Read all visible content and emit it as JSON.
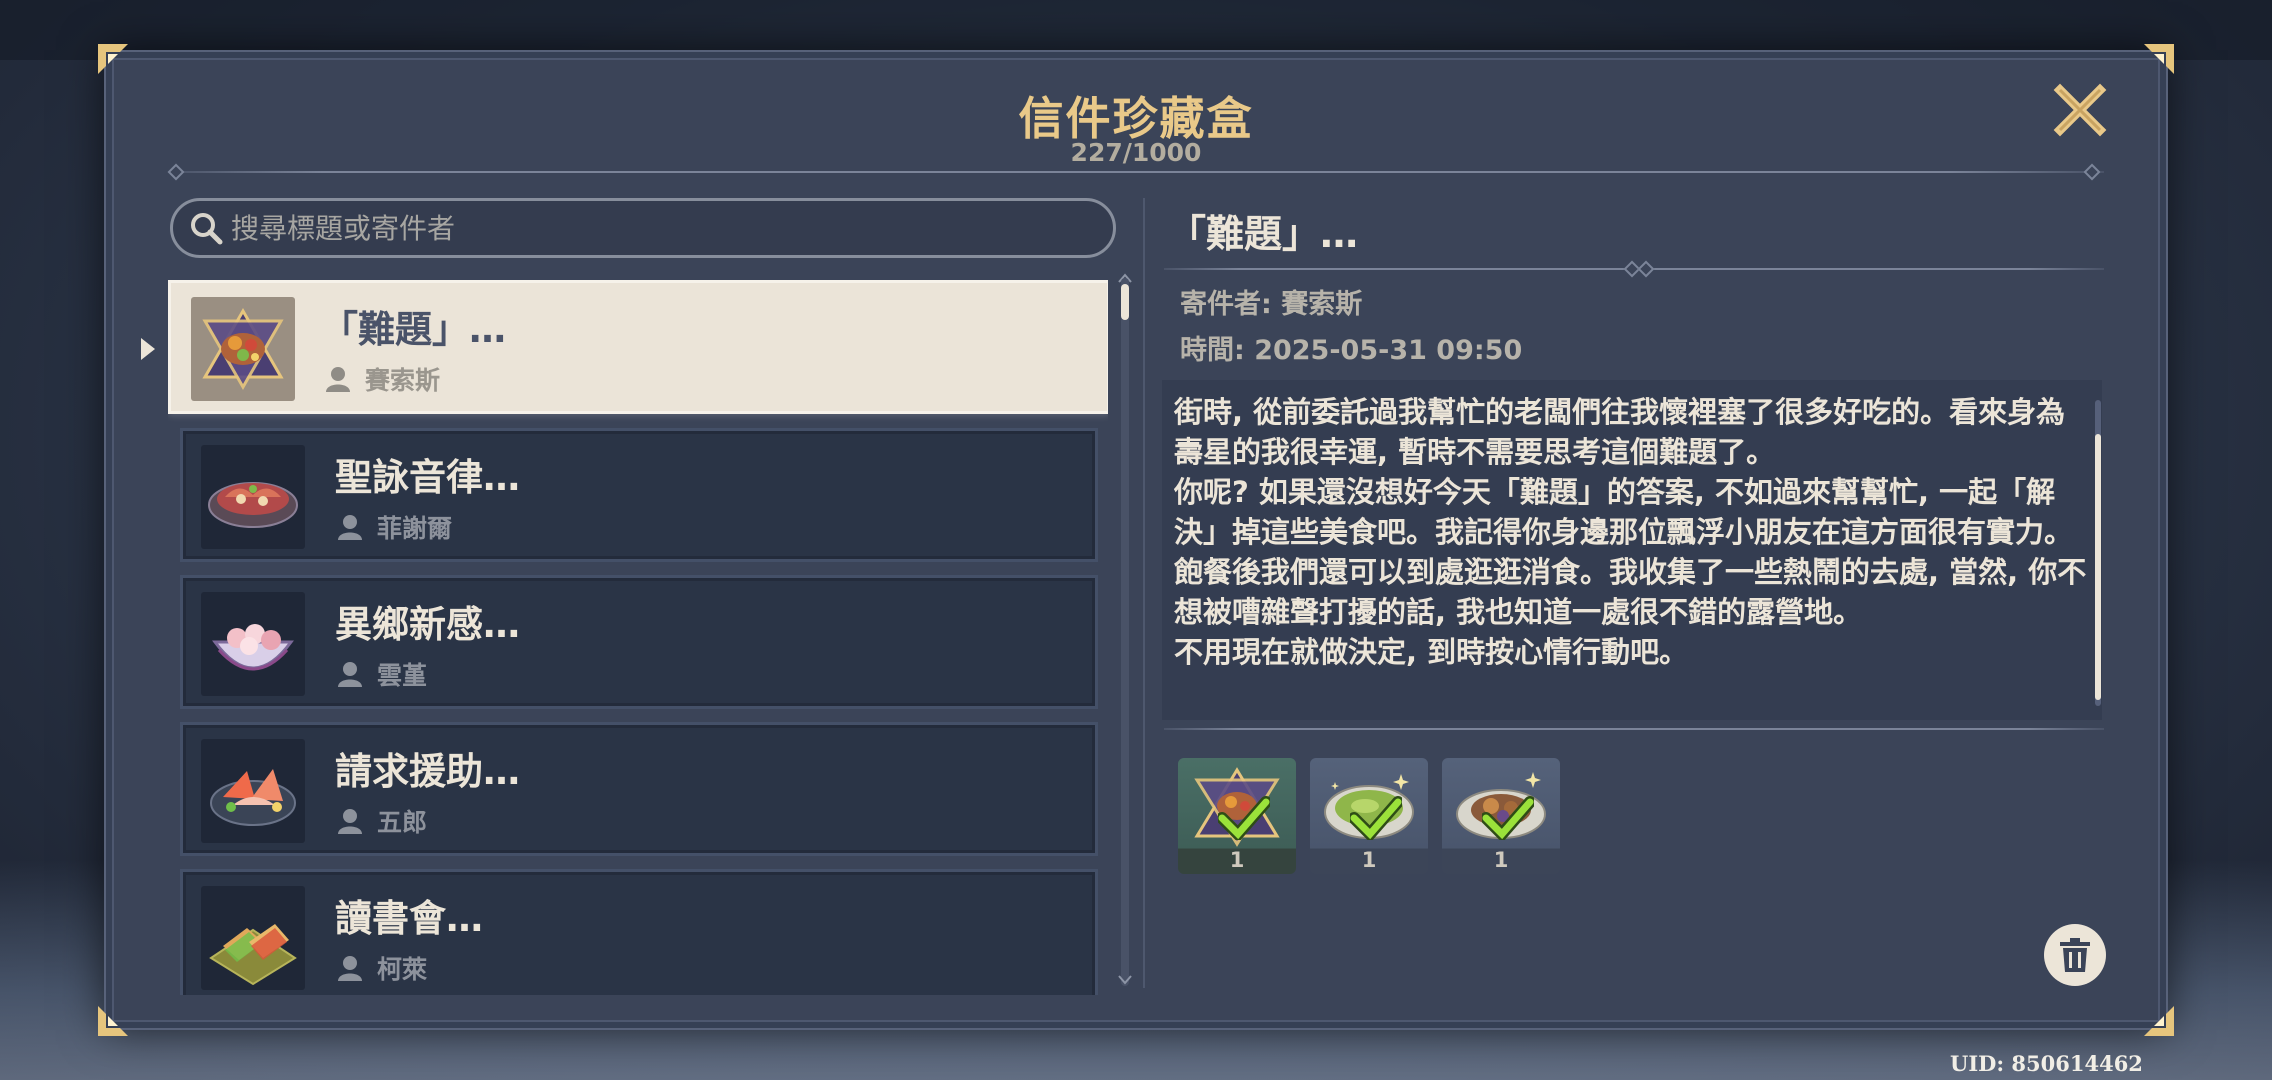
{
  "window": {
    "title": "信件珍藏盒",
    "count": "227/1000"
  },
  "search": {
    "placeholder": "搜尋標題或寄件者"
  },
  "letters": [
    {
      "subject": "「難題」…",
      "sender": "賽索斯",
      "icon": "festive-dish-icon",
      "selected": true
    },
    {
      "subject": "聖詠音律…",
      "sender": "菲謝爾",
      "icon": "roast-platter-icon",
      "selected": false
    },
    {
      "subject": "異鄉新感…",
      "sender": "雲堇",
      "icon": "rice-balls-bowl-icon",
      "selected": false
    },
    {
      "subject": "請求援助…",
      "sender": "五郎",
      "icon": "sashimi-platter-icon",
      "selected": false
    },
    {
      "subject": "讀書會…",
      "sender": "柯萊",
      "icon": "sandwich-plate-icon",
      "selected": false
    }
  ],
  "detail": {
    "title": "「難題」…",
    "sender_line": "寄件者: 賽索斯",
    "time_line": "時間: 2025-05-31 09:50",
    "body": "街時, 從前委託過我幫忙的老闆們往我懷裡塞了很多好吃的。看來身為壽星的我很幸運, 暫時不需要思考這個難題了。\n你呢? 如果還沒想好今天「難題」的答案, 不如過來幫幫忙, 一起「解決」掉這些美食吧。我記得你身邊那位飄浮小朋友在這方面很有實力。\n飽餐後我們還可以到處逛逛消食。我收集了一些熱鬧的去處, 當然, 你不想被嘈雜聲打擾的話, 我也知道一處很不錯的露營地。\n不用現在就做決定, 到時按心情行動吧。",
    "attachments": [
      {
        "icon": "festive-dish-icon",
        "qty": "1",
        "claimed": true
      },
      {
        "icon": "green-soup-icon",
        "qty": "1",
        "claimed": true
      },
      {
        "icon": "stew-plate-icon",
        "qty": "1",
        "claimed": true
      }
    ]
  },
  "footer": {
    "uid": "UID: 850614462"
  },
  "colors": {
    "accent_gold": "#e9c989",
    "panel": "#3b4458",
    "check_green": "#9be23a",
    "selected_bg": "#ebe4d8"
  }
}
